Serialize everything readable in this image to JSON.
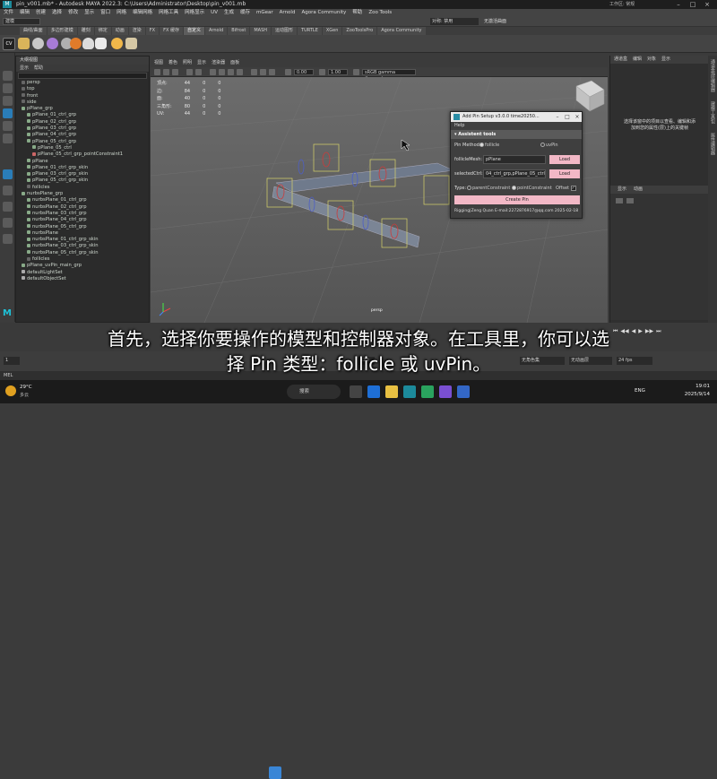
{
  "titlebar": {
    "title": "pin_v001.mb* - Autodesk MAYA 2022.3: C:\\Users\\Administrator\\Desktop\\pin_v001.mb",
    "workspace": "工作区: 常规"
  },
  "menubar": [
    "文件",
    "编辑",
    "创建",
    "选择",
    "修改",
    "显示",
    "窗口",
    "网格",
    "编辑网格",
    "网格工具",
    "网格显示",
    "UV",
    "生成",
    "缓存",
    "mGear",
    "Arnold",
    "Agora Community",
    "帮助",
    "Zoo Tools"
  ],
  "statusline": {
    "mode": "建模",
    "sym": "对称: 禁用",
    "no_live": "无激活曲面"
  },
  "shelf_tabs": [
    "曲线/曲面",
    "多边形建模",
    "雕刻",
    "绑定",
    "动画",
    "渲染",
    "FX",
    "FX 缓存",
    "自定义",
    "Arnold",
    "Bifrost",
    "MASH",
    "运动图形",
    "TURTLE",
    "XGen",
    "ZooToolsPro",
    "Agora Community"
  ],
  "shelf_active_tab": "自定义",
  "outliner": {
    "title": "大纲视图",
    "menu": [
      "显示",
      "帮助"
    ],
    "items": [
      {
        "label": "persp",
        "indent": 1,
        "color": "#666"
      },
      {
        "label": "top",
        "indent": 1,
        "color": "#666"
      },
      {
        "label": "front",
        "indent": 1,
        "color": "#666"
      },
      {
        "label": "side",
        "indent": 1,
        "color": "#666"
      },
      {
        "label": "pPlane_grp",
        "indent": 1,
        "color": "#8a8"
      },
      {
        "label": "pPlane_01_ctrl_grp",
        "indent": 2,
        "color": "#8a8"
      },
      {
        "label": "pPlane_02_ctrl_grp",
        "indent": 2,
        "color": "#8a8"
      },
      {
        "label": "pPlane_03_ctrl_grp",
        "indent": 2,
        "color": "#8a8"
      },
      {
        "label": "pPlane_04_ctrl_grp",
        "indent": 2,
        "color": "#8a8"
      },
      {
        "label": "pPlane_05_ctrl_grp",
        "indent": 2,
        "color": "#8a8"
      },
      {
        "label": "pPlane_05_ctrl",
        "indent": 3,
        "color": "#8a8"
      },
      {
        "label": "pPlane_05_ctrl_grp_pointConstraint1",
        "indent": 3,
        "color": "#c66"
      },
      {
        "label": "pPlane",
        "indent": 2,
        "color": "#8a8"
      },
      {
        "label": "pPlane_01_ctrl_grp_skin",
        "indent": 2,
        "color": "#8a8"
      },
      {
        "label": "pPlane_03_ctrl_grp_skin",
        "indent": 2,
        "color": "#8a8"
      },
      {
        "label": "pPlane_05_ctrl_grp_skin",
        "indent": 2,
        "color": "#8a8"
      },
      {
        "label": "follicles",
        "indent": 2,
        "color": "#666"
      },
      {
        "label": "nurbsPlane_grp",
        "indent": 1,
        "color": "#8a8"
      },
      {
        "label": "nurbsPlane_01_ctrl_grp",
        "indent": 2,
        "color": "#8a8"
      },
      {
        "label": "nurbsPlane_02_ctrl_grp",
        "indent": 2,
        "color": "#8a8"
      },
      {
        "label": "nurbsPlane_03_ctrl_grp",
        "indent": 2,
        "color": "#8a8"
      },
      {
        "label": "nurbsPlane_04_ctrl_grp",
        "indent": 2,
        "color": "#8a8"
      },
      {
        "label": "nurbsPlane_05_ctrl_grp",
        "indent": 2,
        "color": "#8a8"
      },
      {
        "label": "nurbsPlane",
        "indent": 2,
        "color": "#8a8"
      },
      {
        "label": "nurbsPlane_01_ctrl_grp_skin",
        "indent": 2,
        "color": "#8a8"
      },
      {
        "label": "nurbsPlane_03_ctrl_grp_skin",
        "indent": 2,
        "color": "#8a8"
      },
      {
        "label": "nurbsPlane_05_ctrl_grp_skin",
        "indent": 2,
        "color": "#8a8"
      },
      {
        "label": "follicles",
        "indent": 2,
        "color": "#666"
      },
      {
        "label": "pPlane_uvPin_main_grp",
        "indent": 1,
        "color": "#8a8"
      },
      {
        "label": "defaultLightSet",
        "indent": 1,
        "color": "#aaa"
      },
      {
        "label": "defaultObjectSet",
        "indent": 1,
        "color": "#aaa"
      }
    ]
  },
  "viewport": {
    "menu": [
      "视图",
      "着色",
      "照明",
      "显示",
      "渲染器",
      "面板"
    ],
    "exposure": "0.00",
    "gamma": "1.00",
    "color_space": "sRGB gamma (legacy)",
    "camera_label": "persp",
    "hud": [
      {
        "label": "顶点:",
        "a": "44",
        "b": "0",
        "c": "0"
      },
      {
        "label": "边:",
        "a": "84",
        "b": "0",
        "c": "0"
      },
      {
        "label": "面:",
        "a": "40",
        "b": "0",
        "c": "0"
      },
      {
        "label": "三角形:",
        "a": "80",
        "b": "0",
        "c": "0"
      },
      {
        "label": "UV:",
        "a": "44",
        "b": "0",
        "c": "0"
      }
    ]
  },
  "dialog": {
    "title": "Add Pin Setup v3.0.0 time20250...",
    "help": "Help",
    "section": "Assistent tools",
    "pin_method_label": "Pin Method:",
    "pin_methods": [
      "follicle",
      "uvPin"
    ],
    "pin_method_selected": "follicle",
    "follicle_mesh_label": "follicleMesh:",
    "follicle_mesh_value": "pPlane",
    "selected_ctrl_label": "selectedCtrl:",
    "selected_ctrl_value": "04_ctrl_grp,pPlane_05_ctrl_grp",
    "load_label": "Load",
    "type_label": "Type:",
    "types": [
      "parentConstraint",
      "pointConstraint"
    ],
    "offset_label": "Offset",
    "create_label": "Create Pin",
    "footer": "Rigging|Zeng Quan E-mail:2272876917@qq.com 2025-02-18"
  },
  "right_panel": {
    "tabs": [
      "通道盒",
      "编辑",
      "对象",
      "显示"
    ],
    "message": "选择该窗中的项目以查看、编辑和添加到您的属性(层)上的关键帧",
    "layer_tabs": [
      "显示",
      "动画"
    ]
  },
  "sidebar_tabs": [
    "通道盒/层编辑器",
    "建模工具包",
    "属性编辑器"
  ],
  "timeline": {
    "fps": "24 fps",
    "char": "无角色集",
    "layer": "无动画层",
    "start": "1",
    "end": "120"
  },
  "cmdline": {
    "label": "MEL"
  },
  "subtitles": {
    "line1": "首先，选择你要操作的模型和控制器对象。在工具里，你可以选",
    "line2": "择 Pin 类型：follicle 或 uvPin。"
  },
  "taskbar": {
    "weather_temp": "29°C",
    "weather_desc": "多云",
    "search": "搜索",
    "lang": "ENG",
    "time": "19:01",
    "date": "2025/9/14"
  }
}
